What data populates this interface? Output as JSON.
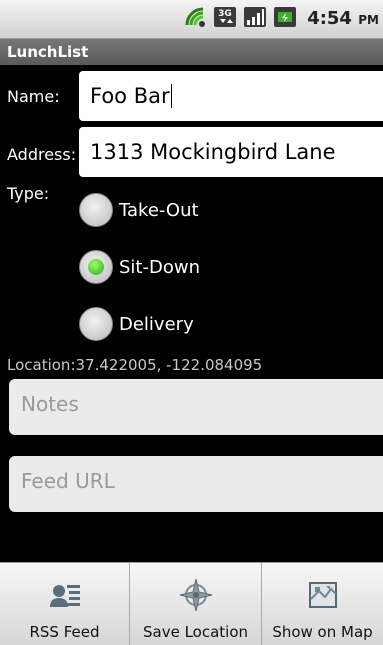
{
  "status_bar": {
    "time": "4:54",
    "ampm": "PM",
    "icons": [
      "wifi-icon",
      "3g-icon",
      "signal-icon",
      "battery-icon"
    ]
  },
  "title_bar": {
    "title": "LunchList"
  },
  "form": {
    "name_label": "Name:",
    "name_value": "Foo Bar",
    "address_label": "Address:",
    "address_value": "1313 Mockingbird Lane",
    "type_label": "Type:",
    "types": [
      {
        "label": "Take-Out",
        "checked": false
      },
      {
        "label": "Sit-Down",
        "checked": true
      },
      {
        "label": "Delivery",
        "checked": false
      }
    ],
    "location": "Location:37.422005, -122.084095",
    "notes_placeholder": "Notes",
    "feed_placeholder": "Feed URL"
  },
  "menu": {
    "items": [
      {
        "label": "RSS Feed",
        "icon": "rss-feed-icon"
      },
      {
        "label": "Save Location",
        "icon": "compass-icon"
      },
      {
        "label": "Show on Map",
        "icon": "map-icon"
      }
    ]
  }
}
